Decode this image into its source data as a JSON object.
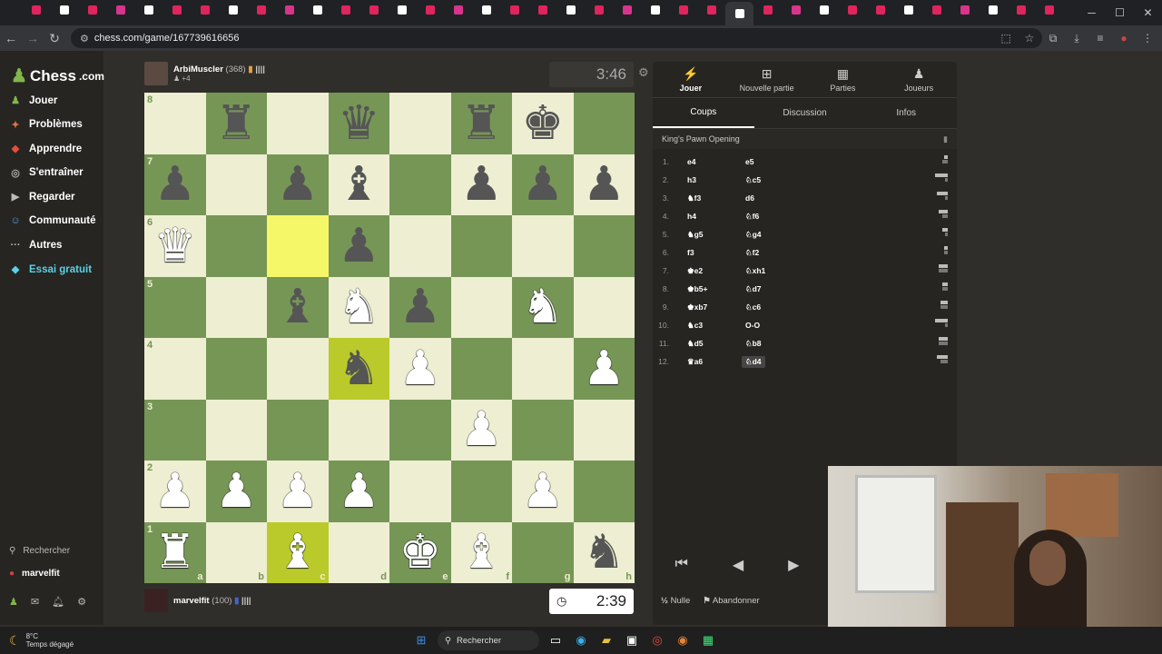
{
  "browser": {
    "url": "chess.com/game/167739616656",
    "tab_count": 37
  },
  "sidebar": {
    "logo_text": "Chess",
    "logo_suffix": ".com",
    "items": [
      {
        "label": "Jouer",
        "icon": "play-icon",
        "color": "#81b64c"
      },
      {
        "label": "Problèmes",
        "icon": "puzzle-icon",
        "color": "#e2743a"
      },
      {
        "label": "Apprendre",
        "icon": "learn-icon",
        "color": "#e84c3d"
      },
      {
        "label": "S'entraîner",
        "icon": "train-icon",
        "color": "#aaa"
      },
      {
        "label": "Regarder",
        "icon": "watch-icon",
        "color": "#bbb"
      },
      {
        "label": "Communauté",
        "icon": "community-icon",
        "color": "#5aa0dd"
      },
      {
        "label": "Autres",
        "icon": "more-icon",
        "color": "#bbb"
      },
      {
        "label": "Essai gratuit",
        "icon": "diamond-icon",
        "color": "#5ad1e6"
      }
    ],
    "search_label": "Rechercher",
    "user_label": "marvelfit"
  },
  "top_player": {
    "name": "ArbiMuscler",
    "rating": "(368)",
    "sub": "+4"
  },
  "bottom_player": {
    "name": "marvelfit",
    "rating": "(100)"
  },
  "clock_top": "3:46",
  "clock_bottom": "2:39",
  "board": {
    "ranks": [
      "8",
      "7",
      "6",
      "5",
      "4",
      "3",
      "2",
      "1"
    ],
    "files": [
      "a",
      "b",
      "c",
      "d",
      "e",
      "f",
      "g",
      "h"
    ],
    "position": [
      [
        "",
        "bR",
        "",
        "bQ",
        "",
        "bR",
        "bK",
        ""
      ],
      [
        "bP",
        "",
        "bP",
        "bB",
        "",
        "bP",
        "bP",
        "bP"
      ],
      [
        "wQ",
        "",
        "",
        "bP",
        "",
        "",
        "",
        ""
      ],
      [
        "",
        "",
        "bB",
        "wN",
        "bP",
        "",
        "wN",
        ""
      ],
      [
        "",
        "",
        "",
        "bN",
        "wP",
        "",
        "",
        "wP"
      ],
      [
        "",
        "",
        "",
        "",
        "",
        "wP",
        "",
        ""
      ],
      [
        "wP",
        "wP",
        "wP",
        "wP",
        "",
        "",
        "wP",
        ""
      ],
      [
        "wR",
        "",
        "wB",
        "",
        "wK",
        "wB",
        "",
        "bN"
      ]
    ],
    "highlights": [
      [
        2,
        2
      ],
      [
        4,
        3
      ],
      [
        7,
        2
      ]
    ]
  },
  "panel": {
    "tabs": [
      {
        "label": "Jouer",
        "icon": "lightning-icon"
      },
      {
        "label": "Nouvelle partie",
        "icon": "plus-icon"
      },
      {
        "label": "Parties",
        "icon": "board-icon"
      },
      {
        "label": "Joueurs",
        "icon": "players-icon"
      }
    ],
    "subtabs": [
      "Coups",
      "Discussion",
      "Infos"
    ],
    "opening": "King's Pawn Opening",
    "moves": [
      {
        "num": "1.",
        "white": "e4",
        "black": "e5"
      },
      {
        "num": "2.",
        "white": "h3",
        "black": "♘c5"
      },
      {
        "num": "3.",
        "white": "♞f3",
        "black": "d6"
      },
      {
        "num": "4.",
        "white": "h4",
        "black": "♘f6"
      },
      {
        "num": "5.",
        "white": "♞g5",
        "black": "♘g4"
      },
      {
        "num": "6.",
        "white": "f3",
        "black": "♘f2"
      },
      {
        "num": "7.",
        "white": "♚e2",
        "black": "♘xh1"
      },
      {
        "num": "8.",
        "white": "♚b5+",
        "black": "♘d7"
      },
      {
        "num": "9.",
        "white": "♚xb7",
        "black": "♘c6"
      },
      {
        "num": "10.",
        "white": "♞c3",
        "black": "O-O"
      },
      {
        "num": "11.",
        "white": "♞d5",
        "black": "♘b8"
      },
      {
        "num": "12.",
        "white": "♛a6",
        "black": "♘d4"
      }
    ],
    "draw_label": "Nulle",
    "resign_label": "Abandonner"
  },
  "taskbar": {
    "temp": "8°C",
    "weather": "Temps dégagé",
    "search": "Rechercher"
  }
}
